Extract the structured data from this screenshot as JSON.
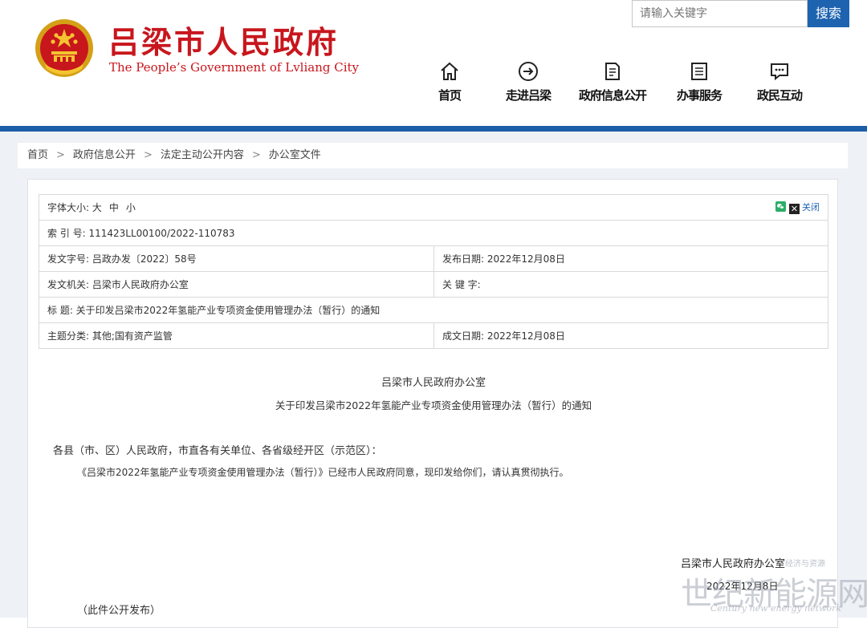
{
  "header": {
    "site_title": "吕梁市人民政府",
    "site_subtitle": "The People’s Government of Lvliang City",
    "search_placeholder": "请输入关键字",
    "search_button": "搜索",
    "nav": [
      {
        "label": "首页",
        "icon": "home-icon"
      },
      {
        "label": "走进吕梁",
        "icon": "arrow-circle-icon"
      },
      {
        "label": "政府信息公开",
        "icon": "document-icon"
      },
      {
        "label": "办事服务",
        "icon": "list-icon"
      },
      {
        "label": "政民互动",
        "icon": "chat-icon"
      }
    ]
  },
  "breadcrumb": [
    "首页",
    "政府信息公开",
    "法定主动公开内容",
    "办公室文件"
  ],
  "meta": {
    "font_size_label": "字体大小:",
    "font_sizes": [
      "大",
      "中",
      "小"
    ],
    "close_label": "关闭",
    "index_no": "索  引  号: 111423LL00100/2022-110783",
    "doc_no": "发文字号: 吕政办发〔2022〕58号",
    "publish_date": "发布日期: 2022年12月08日",
    "issuer": "发文机关: 吕梁市人民政府办公室",
    "keywords": "关  键  字:",
    "title": "标      题: 关于印发吕梁市2022年氢能产业专项资金使用管理办法（暂行）的通知",
    "category": "主题分类: 其他;国有资产监管",
    "created_date": "成文日期: 2022年12月08日"
  },
  "document": {
    "issuer": "吕梁市人民政府办公室",
    "title": "关于印发吕梁市2022年氢能产业专项资金使用管理办法（暂行）的通知",
    "salutation": "各县（市、区）人民政府，市直各有关单位、各省级经开区（示范区）：",
    "body": "《吕梁市2022年氢能产业专项资金使用管理办法（暂行）》已经市人民政府同意，现印发给你们，请认真贯彻执行。",
    "sign_org": "吕梁市人民政府办公室",
    "sign_date": "2022年12月8日",
    "footnote": "（此件公开发布）"
  },
  "watermark": {
    "main": "世纪新能源网",
    "sub": "Century new energy network",
    "small": "经济与资源"
  },
  "colors": {
    "brand_red": "#c8161d",
    "accent_blue": "#1a5ea8",
    "search_blue": "#1d63b0"
  }
}
